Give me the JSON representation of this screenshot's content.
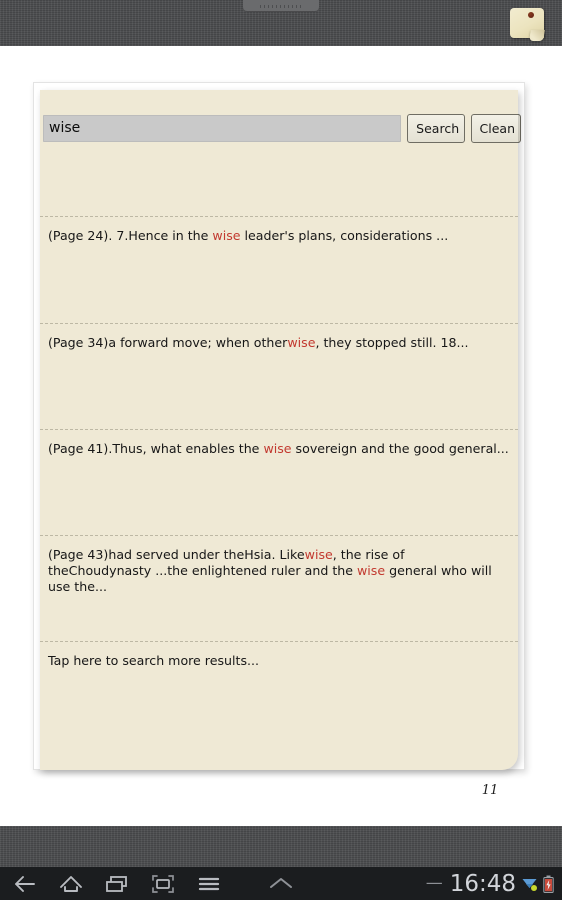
{
  "device": {
    "speaker_grille": "speaker-grille",
    "note_icon_label": "sticky-note"
  },
  "search": {
    "value": "wise",
    "placeholder": "",
    "search_label": "Search",
    "clean_label": "Clean"
  },
  "results": [
    {
      "prefix": "(Page 24). 7.Hence in the ",
      "highlight": "wise",
      "suffix": " leader's plans, considerations ..."
    },
    {
      "prefix": "(Page 34)a forward move; when other",
      "highlight": "wise",
      "suffix": ", they stopped still. 18..."
    },
    {
      "prefix": "(Page 41).Thus, what enables the ",
      "highlight": "wise",
      "suffix": " sovereign and the good general..."
    },
    {
      "prefix": "(Page 43)had served under theHsia. Like",
      "highlight": "wise",
      "suffix": ", the rise of theChoudynasty ...the enlightened ruler and the ",
      "highlight2": "wise",
      "suffix2": " general who will use the..."
    },
    {
      "prefix": "Tap here to search more results...",
      "highlight": "",
      "suffix": ""
    }
  ],
  "page_number": "11",
  "navbar": {
    "back_label": "back-arrow",
    "home_label": "home",
    "recents_label": "recent-apps",
    "screenshot_label": "screenshot",
    "menu_label": "menu",
    "expand_label": "expand-up",
    "dash": "—",
    "clock": "16:48",
    "wifi_label": "wifi",
    "battery_label": "battery"
  },
  "colors": {
    "highlight": "#c2392f",
    "panel": "#efe9d5",
    "input": "#c9c9c9",
    "navbar": "#1b1d1f"
  }
}
